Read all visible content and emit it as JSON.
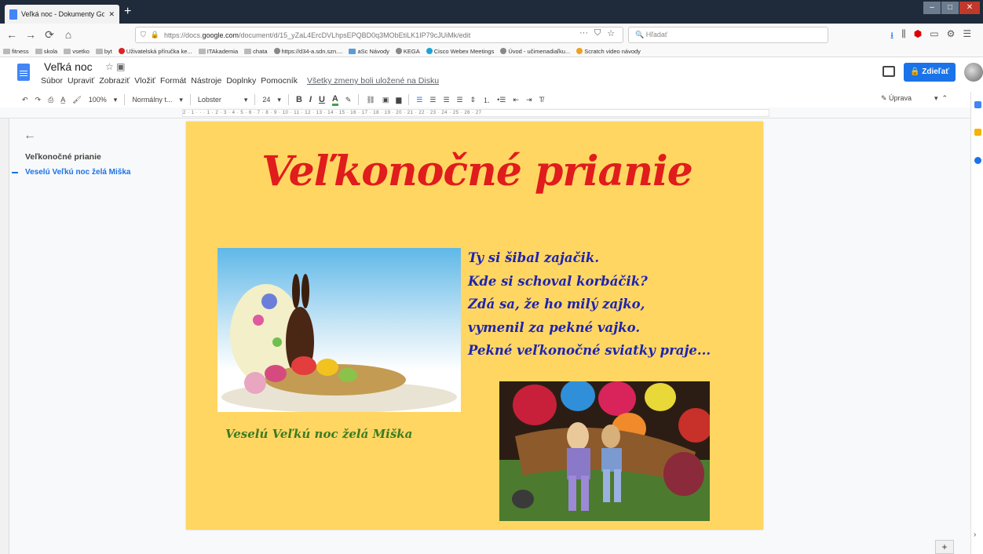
{
  "browser": {
    "tab_title": "Veľká noc - Dokumenty Google",
    "tab_close": "✕",
    "new_tab": "+",
    "url_prefix": "https://docs.",
    "url_domain": "google.com",
    "url_path": "/document/d/15_yZaL4ErcDVLhpsEPQBD0q3MObEtiLK1IP79cJUiMk/edit",
    "url_more": "···",
    "search_placeholder": "Hľadať",
    "bookmarks": [
      "fitness",
      "skola",
      "vsetko",
      "byt",
      "Uživatelská příručka ke...",
      "ITAkademia",
      "chata",
      "https://d34-a.sdn.szn....",
      "aSc Návody",
      "KEGA",
      "Cisco Webex Meetings",
      "Úvod - učimenadiaľku...",
      "Scratch video návody"
    ]
  },
  "docs": {
    "title": "Veľká noc",
    "menu": [
      "Súbor",
      "Upraviť",
      "Zobraziť",
      "Vložiť",
      "Formát",
      "Nástroje",
      "Doplnky",
      "Pomocník"
    ],
    "saved_status": "Všetky zmeny boli uložené na Disku",
    "share_label": "Zdieľať",
    "share_icon": "🔒",
    "toolbar": {
      "zoom": "100%",
      "style": "Normálny t...",
      "font": "Lobster",
      "size": "24",
      "bold": "B",
      "italic": "I",
      "underline": "U",
      "text_color": "A",
      "mode": "Úprava"
    },
    "ruler_text": "2 · 1 · · · 1 · 2 · 3 · 4 · 5 · 6 · 7 · 8 · 9 · 10 · 11 · 12 · 13 · 14 · 15 · 16 · 17 · 18 · 19 · 20 · 21 · 22 · 23 · 24 · 25 · 26 · 27"
  },
  "outline": {
    "title": "Veľkonočné prianie",
    "items": [
      "Veselú Veľkú noc želá Miška"
    ]
  },
  "document": {
    "heading": "Veľkonočné prianie",
    "poem": [
      "Ty si šibal zajačik.",
      "Kde si schoval korbáčik?",
      "Zdá sa, že ho milý zajko,",
      "vymenil za pekné vajko.",
      "Pekné veľkonočné sviatky praje..."
    ],
    "signature": "Veselú Veľkú noc želá Miška"
  },
  "colors": {
    "page_background": "#ffd662",
    "heading": "#e01c1c",
    "poem": "#1f24b0",
    "signature": "#3d7a22",
    "accent": "#1a73e8"
  }
}
